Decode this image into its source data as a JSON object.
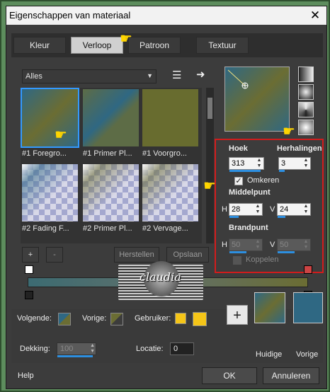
{
  "title": "Eigenschappen van materiaal",
  "close_glyph": "✕",
  "tabs": [
    {
      "label": "Kleur",
      "selected": false
    },
    {
      "label": "Verloop",
      "selected": true
    },
    {
      "label": "Patroon",
      "selected": false
    },
    {
      "label": "Textuur",
      "selected": false
    }
  ],
  "category": {
    "value": "Alles"
  },
  "gallery": {
    "items": [
      {
        "caption": "#1 Foregro...",
        "style": "grad-fg",
        "selected": true
      },
      {
        "caption": "#1 Primer Pl...",
        "style": "grad-pl",
        "selected": false
      },
      {
        "caption": "#1 Voorgro...",
        "style": "solid-olive",
        "selected": false
      },
      {
        "caption": "#2 Fading F...",
        "style": "checker",
        "selected": false
      },
      {
        "caption": "#2 Primer Pl...",
        "style": "checker",
        "selected": false
      },
      {
        "caption": "#2 Vervage...",
        "style": "checker",
        "selected": false
      }
    ]
  },
  "list_buttons": {
    "add": "+",
    "remove": "-",
    "restore": "Herstellen",
    "save": "Opslaan"
  },
  "settings": {
    "hoek_label": "Hoek",
    "hoek_value": "313",
    "herhalingen_label": "Herhalingen",
    "herhalingen_value": "3",
    "omkeren_label": "Omkeren",
    "omkeren_checked": true,
    "middelpunt_label": "Middelpunt",
    "middel_h_label": "H",
    "middel_h": "28",
    "middel_v_label": "V",
    "middel_v": "24",
    "brandpunt_label": "Brandpunt",
    "brand_h_label": "H",
    "brand_h": "50",
    "brand_v_label": "V",
    "brand_v": "50",
    "koppelen_label": "Koppelen",
    "koppelen_checked": false
  },
  "watermark": {
    "text": "claudia"
  },
  "bottom": {
    "volgende_label": "Volgende:",
    "vorige_label": "Vorige:",
    "gebruiker_label": "Gebruiker:",
    "dekking_label": "Dekking:",
    "dekking_value": "100",
    "locatie_label": "Locatie:",
    "locatie_value": "0",
    "huidige_label": "Huidige",
    "vorige_swatch_label": "Vorige",
    "add_glyph": "+"
  },
  "footer": {
    "help": "Help",
    "ok": "OK",
    "cancel": "Annuleren"
  },
  "colors": {
    "gradient_blue": "#2f6883",
    "gradient_olive": "#6b6d33",
    "user_yellow": "#f5c518",
    "accent_blue": "#2d8fe0",
    "highlight_red": "#d21c1c"
  }
}
